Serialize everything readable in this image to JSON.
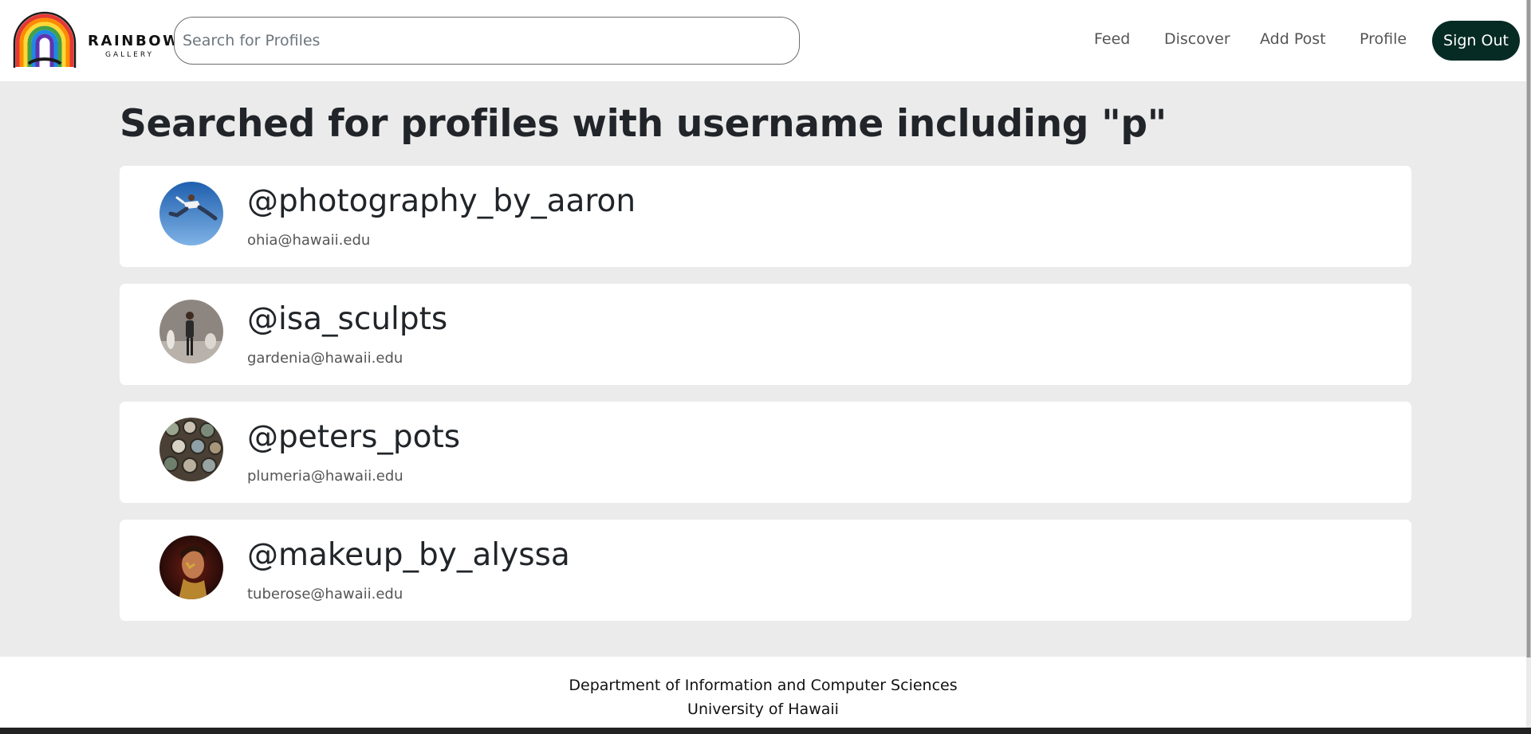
{
  "brand": {
    "name": "RAINBOW",
    "sub": "GALLERY"
  },
  "search": {
    "placeholder": "Search for Profiles",
    "value": ""
  },
  "nav": {
    "feed": "Feed",
    "discover": "Discover",
    "add_post": "Add Post",
    "profile": "Profile",
    "sign_out": "Sign Out"
  },
  "page": {
    "title": "Searched for profiles with username including \"p\""
  },
  "profiles": [
    {
      "username": "@photography_by_aaron",
      "email": "ohia@hawaii.edu",
      "avatar": "jumping-man-photo"
    },
    {
      "username": "@isa_sculpts",
      "email": "gardenia@hawaii.edu",
      "avatar": "sculptor-gallery-photo"
    },
    {
      "username": "@peters_pots",
      "email": "plumeria@hawaii.edu",
      "avatar": "ceramic-pots-photo"
    },
    {
      "username": "@makeup_by_alyssa",
      "email": "tuberose@hawaii.edu",
      "avatar": "makeup-portrait-photo"
    }
  ],
  "footer": {
    "line1": "Department of Information and Computer Sciences",
    "line2": "University of Hawaii"
  },
  "colors": {
    "sign_out_bg": "#062b24",
    "page_bg": "#ebebeb",
    "card_bg": "#ffffff"
  }
}
